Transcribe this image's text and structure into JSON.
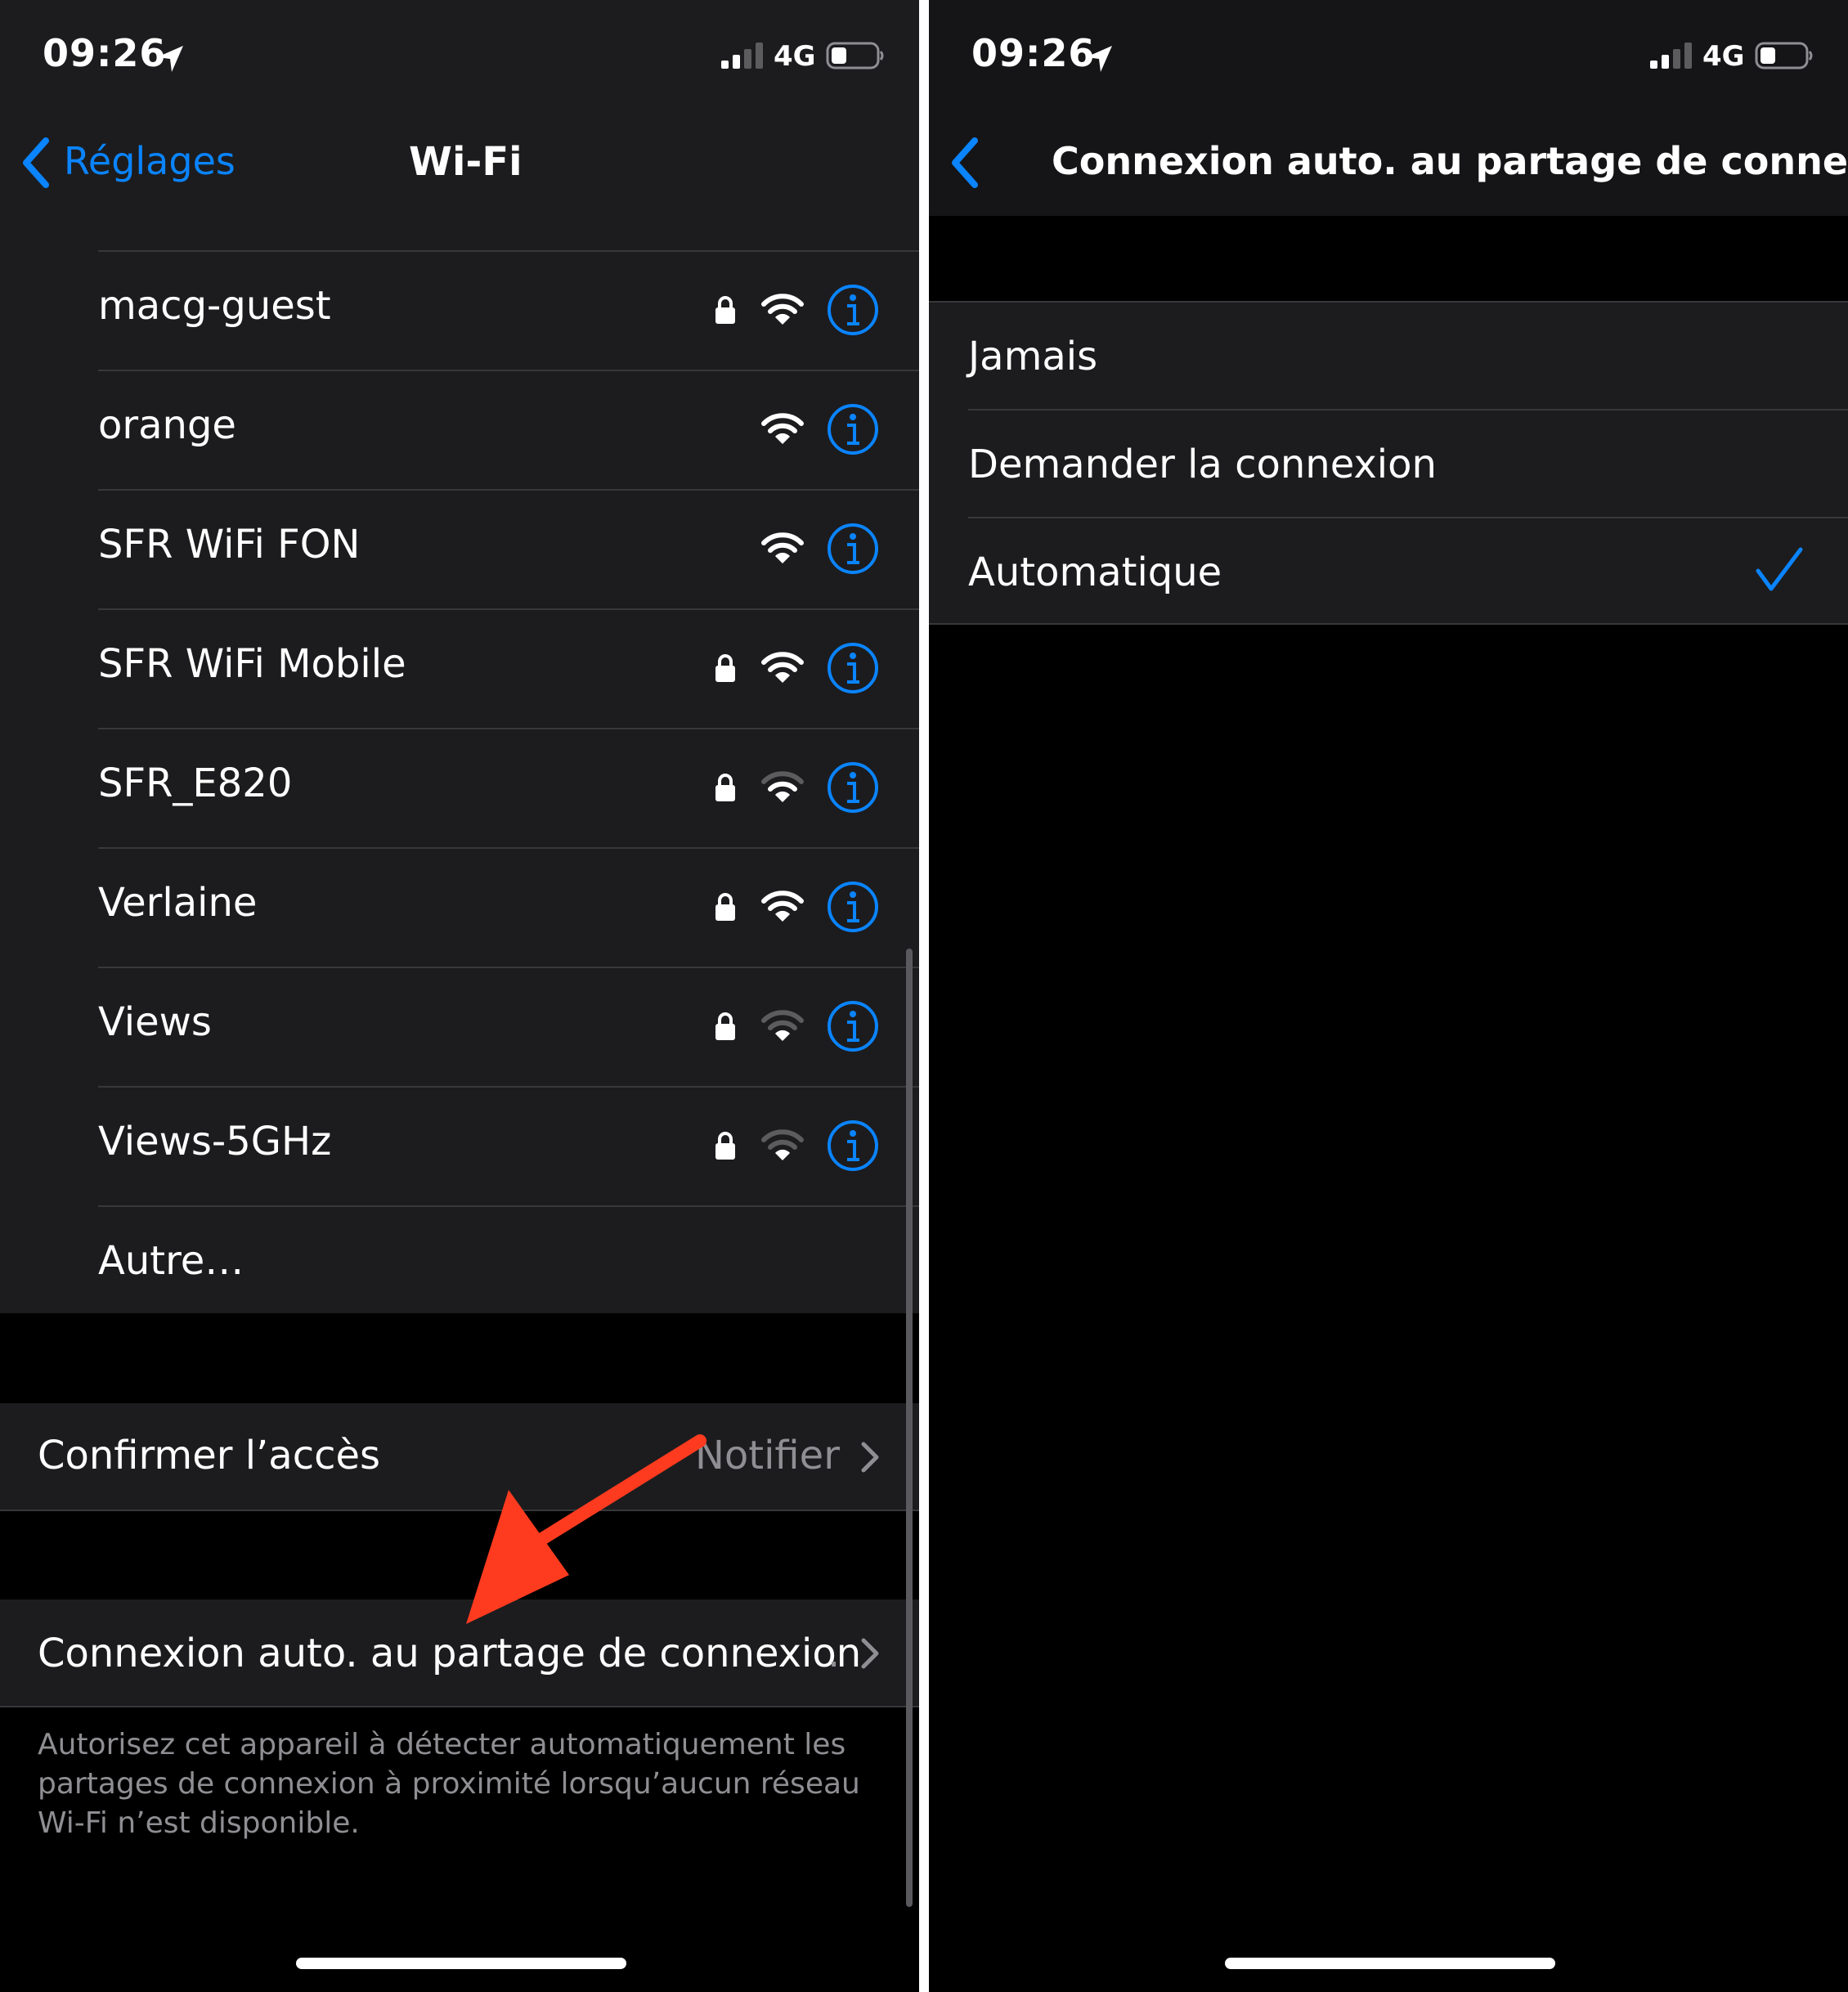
{
  "left": {
    "status": {
      "time": "09:26",
      "network": "4G"
    },
    "nav": {
      "back_label": "Réglages",
      "title": "Wi-Fi"
    },
    "networks": [
      {
        "name": "macg-guest",
        "locked": true,
        "signal": 3
      },
      {
        "name": "orange",
        "locked": false,
        "signal": 3
      },
      {
        "name": "SFR WiFi FON",
        "locked": false,
        "signal": 3
      },
      {
        "name": "SFR WiFi Mobile",
        "locked": true,
        "signal": 3
      },
      {
        "name": "SFR_E820",
        "locked": true,
        "signal": 2
      },
      {
        "name": "Verlaine",
        "locked": true,
        "signal": 3
      },
      {
        "name": "Views",
        "locked": true,
        "signal": 1
      },
      {
        "name": "Views-5GHz",
        "locked": true,
        "signal": 1
      }
    ],
    "other": "Autre…",
    "confirm_access": {
      "label": "Confirmer l’accès",
      "value": "Notifier"
    },
    "auto_hotspot": {
      "label": "Connexion auto. au partage de connexion",
      "truncation": "."
    },
    "footer": "Autorisez cet appareil à détecter automatiquement les partages de connexion à proximité lorsqu’aucun réseau Wi-Fi n’est disponible."
  },
  "right": {
    "status": {
      "time": "09:26",
      "network": "4G"
    },
    "nav": {
      "title": "Connexion auto. au partage de conne..."
    },
    "options": [
      {
        "label": "Jamais",
        "selected": false
      },
      {
        "label": "Demander la connexion",
        "selected": false
      },
      {
        "label": "Automatique",
        "selected": true
      }
    ]
  },
  "colors": {
    "accent": "#0a84ff",
    "cell_background": "#1c1c1e",
    "background": "#000000",
    "separator": "#38383a",
    "secondary_text": "#8e8e93",
    "annotation_arrow": "#ff3b1f"
  },
  "icons": {
    "back": "chevron-left-icon",
    "location": "location-arrow-icon",
    "signal": "cellular-signal-icon",
    "battery": "battery-icon",
    "lock": "lock-icon",
    "wifi": "wifi-icon",
    "info": "info-icon",
    "chevron": "chevron-right-icon",
    "check": "checkmark-icon"
  }
}
